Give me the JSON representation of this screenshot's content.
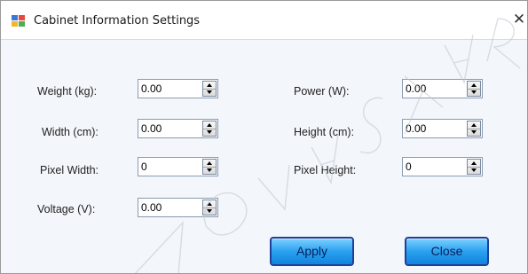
{
  "window": {
    "title": "Cabinet Information Settings",
    "close_glyph": "✕",
    "icon": "settings-window-icon",
    "watermark": "NOVASTAR"
  },
  "fields": {
    "weight": {
      "label": "Weight (kg):",
      "value": "0.00"
    },
    "power": {
      "label": "Power (W):",
      "value": "0.00"
    },
    "width": {
      "label": "Width (cm):",
      "value": "0.00"
    },
    "height": {
      "label": "Height (cm):",
      "value": "0.00"
    },
    "pixel_width": {
      "label": "Pixel Width:",
      "value": "0"
    },
    "pixel_height": {
      "label": "Pixel Height:",
      "value": "0"
    },
    "voltage": {
      "label": "Voltage (V):",
      "value": "0.00"
    }
  },
  "buttons": {
    "apply": "Apply",
    "close": "Close"
  },
  "colors": {
    "button_fill": "#2aa1f0",
    "button_border": "#1f3f9a"
  }
}
